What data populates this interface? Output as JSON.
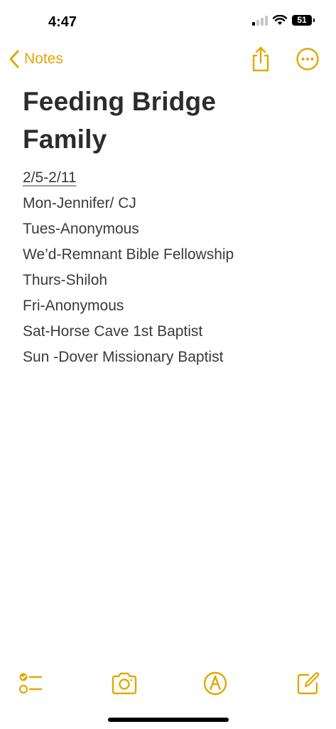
{
  "status_bar": {
    "time": "4:47",
    "battery": "51",
    "icons": [
      "signal-icon",
      "wifi-icon",
      "battery-icon"
    ]
  },
  "nav": {
    "back_label": "Notes",
    "icons": [
      "chevron-left-icon",
      "share-icon",
      "more-icon"
    ]
  },
  "note": {
    "title_line1": "Feeding Bridge",
    "title_line2": "Family",
    "date_range": "2/5-2/11",
    "lines": [
      "Mon-Jennifer/ CJ",
      "Tues-Anonymous",
      "We’d-Remnant Bible Fellowship",
      "Thurs-Shiloh",
      "Fri-Anonymous",
      "Sat-Horse Cave 1st Baptist",
      "Sun -Dover Missionary Baptist"
    ]
  },
  "toolbar": {
    "icons": [
      "checklist-icon",
      "camera-icon",
      "markup-icon",
      "compose-icon"
    ]
  },
  "colors": {
    "accent": "#e2a800",
    "text": "#3a3a3c",
    "title": "#2c2c2e",
    "background": "#ffffff"
  }
}
